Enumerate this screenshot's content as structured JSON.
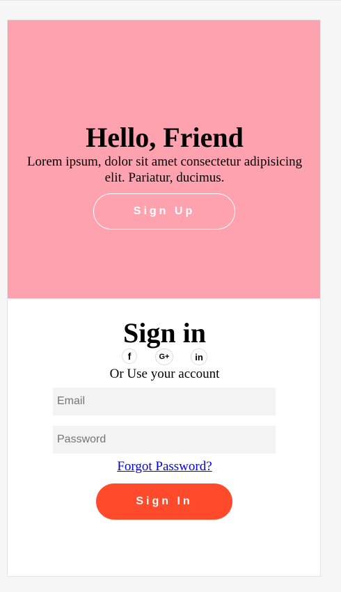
{
  "overlay": {
    "title": "Hello, Friend",
    "text": "Lorem ipsum, dolor sit amet consectetur adipisicing elit. Pariatur, ducimus.",
    "signup_label": "Sign Up",
    "background_color": "#ffa2b0"
  },
  "signin": {
    "title": "Sign in",
    "social_icons": [
      {
        "name": "facebook-icon",
        "glyph": "f"
      },
      {
        "name": "google-plus-icon",
        "glyph": "G+"
      },
      {
        "name": "linkedin-icon",
        "glyph": "in"
      }
    ],
    "subtext": "Or Use your account",
    "email_placeholder": "Email",
    "password_placeholder": "Password",
    "forgot_label": "Forgot Password?",
    "button_label": "Sign In",
    "button_color": "#ff4b2b"
  }
}
